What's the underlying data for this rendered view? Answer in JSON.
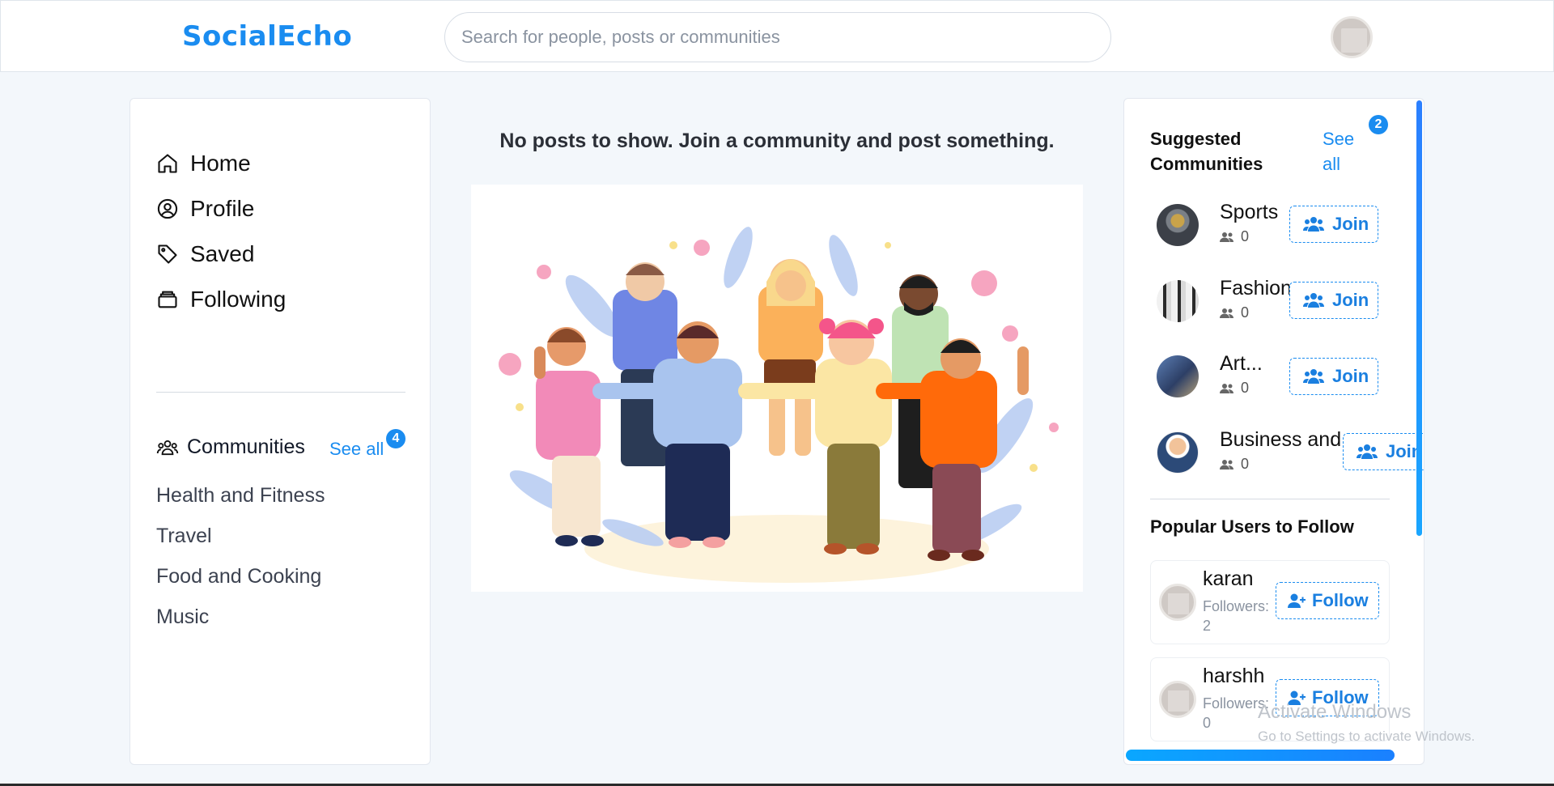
{
  "app": {
    "logo": "SocialEcho"
  },
  "search": {
    "placeholder": "Search for people, posts or communities"
  },
  "nav": {
    "items": [
      {
        "label": "Home",
        "icon": "home-icon"
      },
      {
        "label": "Profile",
        "icon": "user-circle-icon"
      },
      {
        "label": "Saved",
        "icon": "tag-icon"
      },
      {
        "label": "Following",
        "icon": "inbox-icon"
      }
    ]
  },
  "communities": {
    "title": "Communities",
    "see_all": "See all",
    "count": "4",
    "items": [
      "Health and Fitness",
      "Travel",
      "Food and Cooking",
      "Music"
    ]
  },
  "feed": {
    "empty_message": "No posts to show. Join a community and post something."
  },
  "suggested": {
    "title": "Suggested Communities",
    "see_all": "See all",
    "count": "2",
    "join_label": "Join",
    "items": [
      {
        "name": "Sports",
        "members": "0"
      },
      {
        "name": "Fashion",
        "members": "0"
      },
      {
        "name": "Art...",
        "members": "0"
      },
      {
        "name": "Business and...",
        "members": "0"
      }
    ]
  },
  "popular": {
    "title": "Popular Users to Follow",
    "follow_label": "Follow",
    "followers_label": "Followers:",
    "users": [
      {
        "name": "karan",
        "followers": "2"
      },
      {
        "name": "harshh",
        "followers": "0"
      }
    ]
  },
  "watermark": {
    "line1": "Activate Windows",
    "line2": "Go to Settings to activate Windows."
  },
  "colors": {
    "accent": "#1a8cf0",
    "background": "#f3f7fb"
  }
}
